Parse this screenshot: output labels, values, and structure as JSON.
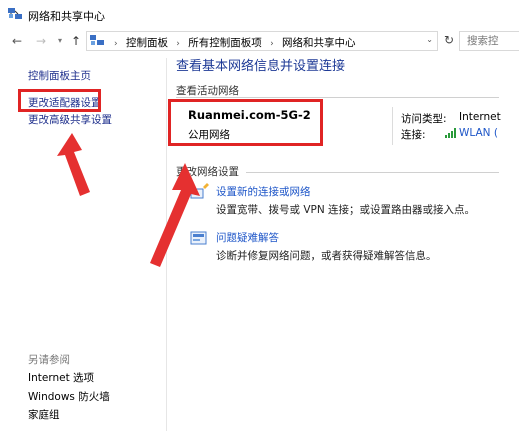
{
  "window": {
    "title": "网络和共享中心"
  },
  "address_bar": {
    "breadcrumbs": [
      "控制面板",
      "所有控制面板项",
      "网络和共享中心"
    ],
    "search_placeholder": "搜索控"
  },
  "sidebar": {
    "home_link": "控制面板主页",
    "links": [
      "更改适配器设置",
      "更改高级共享设置"
    ],
    "see_also_header": "另请参阅",
    "see_also": [
      "Internet 选项",
      "Windows 防火墙",
      "家庭组"
    ]
  },
  "main": {
    "title": "查看基本网络信息并设置连接",
    "active_networks_label": "查看活动网络",
    "network": {
      "name": "Ruanmei.com-5G-2",
      "category": "公用网络",
      "access_type_label": "访问类型:",
      "access_type_value": "Internet",
      "connections_label": "连接:",
      "connections_value": "WLAN ("
    },
    "change_settings_label": "更改网络设置",
    "tasks": [
      {
        "link": "设置新的连接或网络",
        "desc": "设置宽带、拨号或 VPN 连接；或设置路由器或接入点。"
      },
      {
        "link": "问题疑难解答",
        "desc": "诊断并修复网络问题，或者获得疑难解答信息。"
      }
    ]
  },
  "colors": {
    "highlight_red": "#e02424",
    "link_blue": "#1e56c8",
    "title_blue": "#1e3a96"
  },
  "icons": {
    "back": "arrow-left-icon",
    "forward": "arrow-right-icon",
    "up": "arrow-up-icon",
    "refresh": "refresh-icon",
    "wifi": "wifi-signal-icon"
  }
}
